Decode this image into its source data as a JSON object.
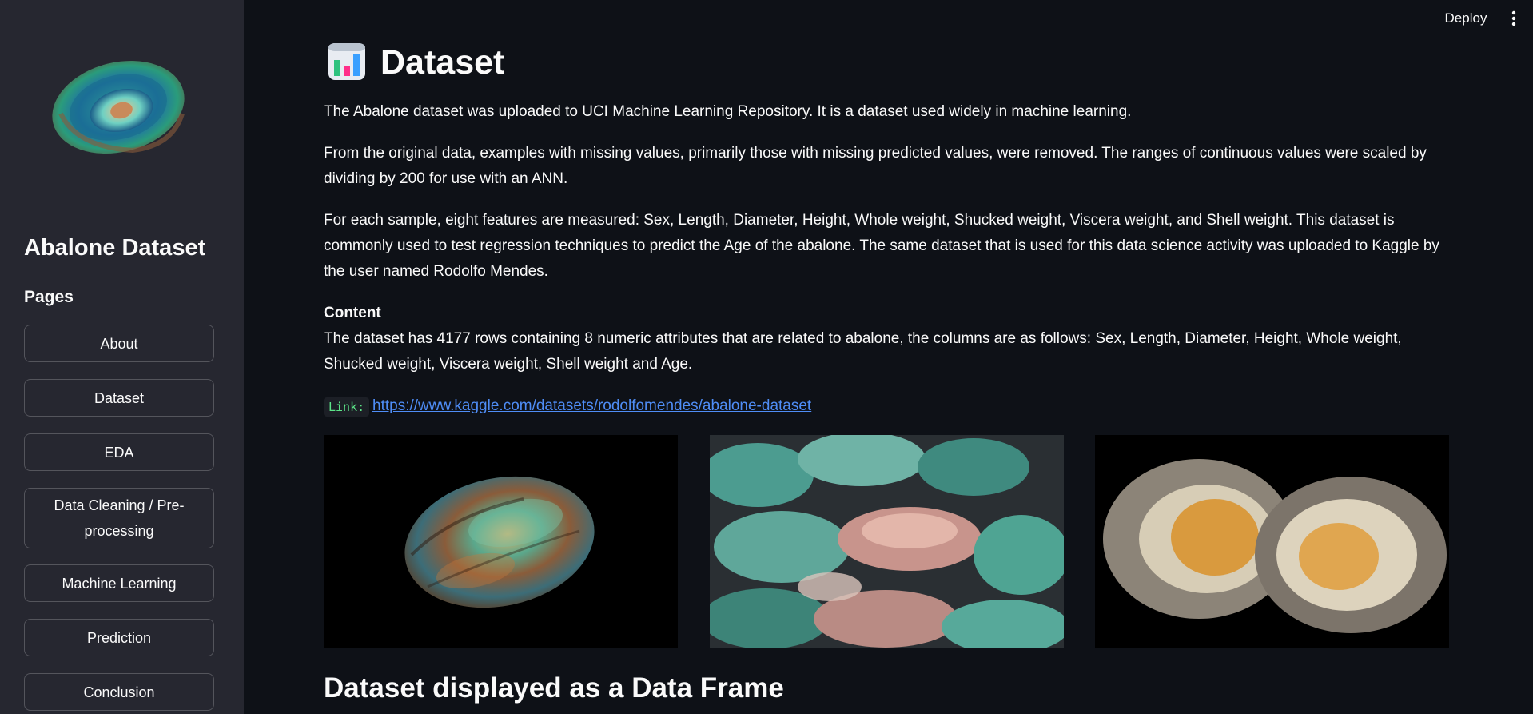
{
  "header": {
    "deploy_label": "Deploy",
    "menu_icon": "kebab-menu-icon"
  },
  "sidebar": {
    "logo_icon": "abalone-shell-logo",
    "title": "Abalone Dataset",
    "pages_label": "Pages",
    "nav": [
      {
        "label": "About"
      },
      {
        "label": "Dataset"
      },
      {
        "label": "EDA"
      },
      {
        "label": "Data Cleaning / Pre-processing"
      },
      {
        "label": "Machine Learning"
      },
      {
        "label": "Prediction"
      },
      {
        "label": "Conclusion"
      }
    ]
  },
  "main": {
    "title_icon": "bar-chart-icon",
    "title": "Dataset",
    "paragraphs": [
      "The Abalone dataset was uploaded to UCI Machine Learning Repository. It is a dataset used widely in machine learning.",
      "From the original data, examples with missing values, primarily those with missing predicted values, were removed. The ranges of continuous values were scaled by dividing by 200 for use with an ANN.",
      "For each sample, eight features are measured: Sex, Length, Diameter, Height, Whole weight, Shucked weight, Viscera weight, and Shell weight. This dataset is commonly used to test regression techniques to predict the Age of the abalone. The same dataset that is used for this data science activity was uploaded to Kaggle by the user named Rodolfo Mendes."
    ],
    "content_heading": "Content",
    "content_text": "The dataset has 4177 rows containing 8 numeric attributes that are related to abalone, the columns are as follows: Sex, Length, Diameter, Height, Whole weight, Shucked weight, Viscera weight, Shell weight and Age.",
    "link_code_label": "Link:",
    "link_url": "https://www.kaggle.com/datasets/rodolfomendes/abalone-dataset",
    "images": [
      {
        "name": "abalone-shell-photo"
      },
      {
        "name": "abalone-pile-photo"
      },
      {
        "name": "abalone-pair-photo"
      }
    ],
    "section_heading": "Dataset displayed as a Data Frame"
  },
  "colors": {
    "background": "#0e1117",
    "sidebar": "#262730",
    "text": "#fafafa",
    "link": "#4f8df6",
    "code": "#5ce488"
  }
}
